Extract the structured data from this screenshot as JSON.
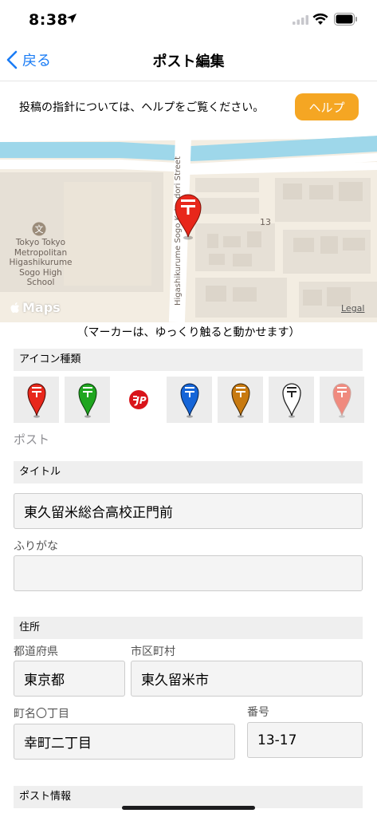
{
  "status": {
    "time": "8:38"
  },
  "nav": {
    "back_label": "戻る",
    "title": "ポスト編集"
  },
  "help": {
    "text": "投稿の指針については、ヘルプをご覧ください。",
    "button_label": "ヘルプ"
  },
  "map": {
    "school_label": "Tokyo Tokyo Metropolitan Higashikurume Sogo High School",
    "street_label": "Higashikurume Sogo Koko-dori Street",
    "block_label": "13",
    "brand": "Maps",
    "legal": "Legal"
  },
  "marker_hint": "（マーカーは、ゆっくり触ると動かせます）",
  "icon_section": {
    "header": "アイコン種類",
    "icons": [
      {
        "name": "red-post-icon",
        "color": "#e8271b",
        "selected": false
      },
      {
        "name": "green-post-icon",
        "color": "#1fa61f",
        "selected": false
      },
      {
        "name": "jp-post-icon",
        "color": "#d9141a",
        "selected": true
      },
      {
        "name": "blue-post-icon",
        "color": "#1565d8",
        "selected": false
      },
      {
        "name": "orange-post-icon",
        "color": "#c87a10",
        "selected": false
      },
      {
        "name": "white-post-icon",
        "color": "#ffffff",
        "selected": false
      },
      {
        "name": "pink-post-icon",
        "color": "#f08a7e",
        "selected": false
      }
    ],
    "selected_name": "ポスト"
  },
  "title_section": {
    "header": "タイトル",
    "title_value": "東久留米総合高校正門前",
    "furigana_label": "ふりがな",
    "furigana_value": ""
  },
  "address_section": {
    "header": "住所",
    "prefecture_label": "都道府県",
    "prefecture_value": "東京都",
    "city_label": "市区町村",
    "city_value": "東久留米市",
    "town_label": "町名〇丁目",
    "town_value": "幸町二丁目",
    "number_label": "番号",
    "number_value": "13-17"
  },
  "post_info_section": {
    "header": "ポスト情報"
  },
  "colors": {
    "accent": "#1a7cf5",
    "help_button": "#f5a623",
    "pin_red": "#e8271b"
  }
}
